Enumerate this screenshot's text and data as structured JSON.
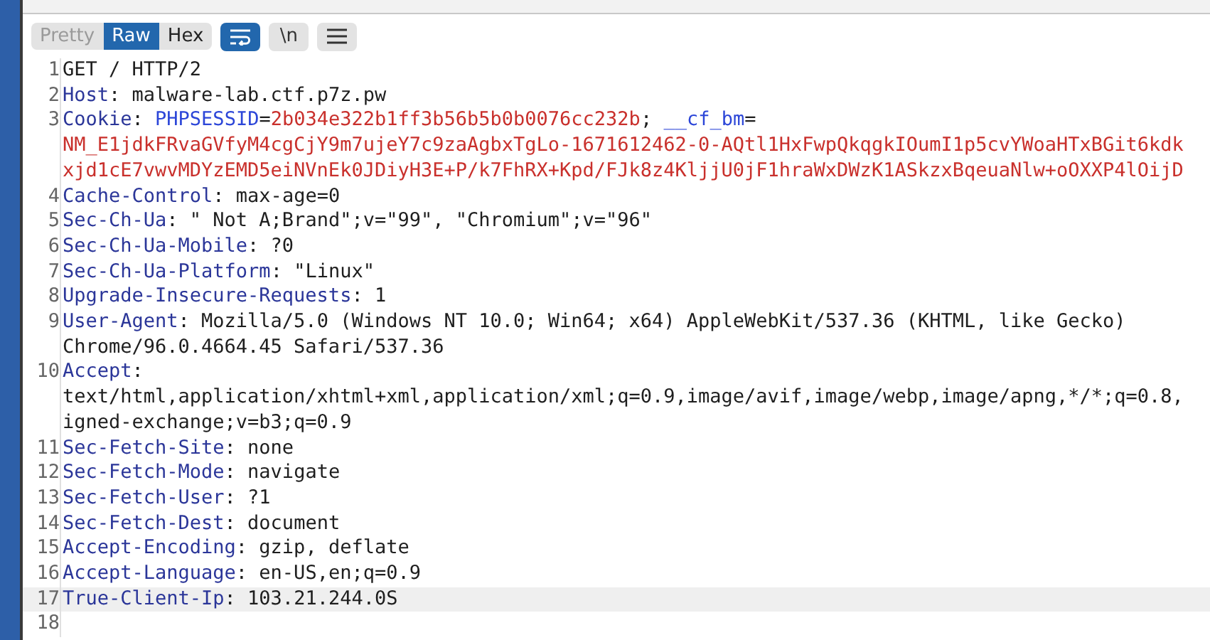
{
  "view_tabs": [
    {
      "label": "Pretty",
      "selected": false
    },
    {
      "label": "Raw",
      "selected": true
    },
    {
      "label": "Hex",
      "selected": false
    }
  ],
  "tools": [
    {
      "kind": "wrap",
      "selected": true
    },
    {
      "kind": "text",
      "label": "\\n",
      "selected": false
    },
    {
      "kind": "menu",
      "selected": false
    }
  ],
  "lines": [
    {
      "number": "1",
      "current": false,
      "rows": [
        [
          {
            "kind": "plain",
            "text": "GET / HTTP/2"
          }
        ]
      ]
    },
    {
      "number": "2",
      "current": false,
      "rows": [
        [
          {
            "kind": "name",
            "text": "Host"
          },
          {
            "kind": "plain",
            "text": ": malware-lab.ctf.p7z.pw"
          }
        ]
      ]
    },
    {
      "number": "3",
      "current": false,
      "rows": [
        [
          {
            "kind": "name",
            "text": "Cookie"
          },
          {
            "kind": "plain",
            "text": ": "
          },
          {
            "kind": "param",
            "text": "PHPSESSID"
          },
          {
            "kind": "plain",
            "text": "="
          },
          {
            "kind": "value",
            "text": "2b034e322b1ff3b56b5b0b0076cc232b"
          },
          {
            "kind": "plain",
            "text": "; "
          },
          {
            "kind": "param",
            "text": "__cf_bm"
          },
          {
            "kind": "plain",
            "text": "="
          }
        ],
        [
          {
            "kind": "value",
            "text": "NM_E1jdkFRvaGVfyM4cgCjY9m7ujeY7c9zaAgbxTgLo-1671612462-0-AQtl1HxFwpQkqgkIOumI1p5cvYWoaHTxBGit6kdk"
          }
        ],
        [
          {
            "kind": "value",
            "text": "xjd1cE7vwvMDYzEMD5eiNVnEk0JDiyH3E+P/k7FhRX+Kpd/FJk8z4KljjU0jF1hraWxDWzK1ASkzxBqeuaNlw+oOXXP4lOijD"
          }
        ]
      ]
    },
    {
      "number": "4",
      "current": false,
      "rows": [
        [
          {
            "kind": "name",
            "text": "Cache-Control"
          },
          {
            "kind": "plain",
            "text": ": max-age=0"
          }
        ]
      ]
    },
    {
      "number": "5",
      "current": false,
      "rows": [
        [
          {
            "kind": "name",
            "text": "Sec-Ch-Ua"
          },
          {
            "kind": "plain",
            "text": ": \" Not A;Brand\";v=\"99\", \"Chromium\";v=\"96\""
          }
        ]
      ]
    },
    {
      "number": "6",
      "current": false,
      "rows": [
        [
          {
            "kind": "name",
            "text": "Sec-Ch-Ua-Mobile"
          },
          {
            "kind": "plain",
            "text": ": ?0"
          }
        ]
      ]
    },
    {
      "number": "7",
      "current": false,
      "rows": [
        [
          {
            "kind": "name",
            "text": "Sec-Ch-Ua-Platform"
          },
          {
            "kind": "plain",
            "text": ": \"Linux\""
          }
        ]
      ]
    },
    {
      "number": "8",
      "current": false,
      "rows": [
        [
          {
            "kind": "name",
            "text": "Upgrade-Insecure-Requests"
          },
          {
            "kind": "plain",
            "text": ": 1"
          }
        ]
      ]
    },
    {
      "number": "9",
      "current": false,
      "rows": [
        [
          {
            "kind": "name",
            "text": "User-Agent"
          },
          {
            "kind": "plain",
            "text": ": Mozilla/5.0 (Windows NT 10.0; Win64; x64) AppleWebKit/537.36 (KHTML, like Gecko)"
          }
        ],
        [
          {
            "kind": "plain",
            "text": "Chrome/96.0.4664.45 Safari/537.36"
          }
        ]
      ]
    },
    {
      "number": "10",
      "current": false,
      "rows": [
        [
          {
            "kind": "name",
            "text": "Accept"
          },
          {
            "kind": "plain",
            "text": ":"
          }
        ],
        [
          {
            "kind": "plain",
            "text": "text/html,application/xhtml+xml,application/xml;q=0.9,image/avif,image/webp,image/apng,*/*;q=0.8,"
          }
        ],
        [
          {
            "kind": "plain",
            "text": "igned-exchange;v=b3;q=0.9"
          }
        ]
      ]
    },
    {
      "number": "11",
      "current": false,
      "rows": [
        [
          {
            "kind": "name",
            "text": "Sec-Fetch-Site"
          },
          {
            "kind": "plain",
            "text": ": none"
          }
        ]
      ]
    },
    {
      "number": "12",
      "current": false,
      "rows": [
        [
          {
            "kind": "name",
            "text": "Sec-Fetch-Mode"
          },
          {
            "kind": "plain",
            "text": ": navigate"
          }
        ]
      ]
    },
    {
      "number": "13",
      "current": false,
      "rows": [
        [
          {
            "kind": "name",
            "text": "Sec-Fetch-User"
          },
          {
            "kind": "plain",
            "text": ": ?1"
          }
        ]
      ]
    },
    {
      "number": "14",
      "current": false,
      "rows": [
        [
          {
            "kind": "name",
            "text": "Sec-Fetch-Dest"
          },
          {
            "kind": "plain",
            "text": ": document"
          }
        ]
      ]
    },
    {
      "number": "15",
      "current": false,
      "rows": [
        [
          {
            "kind": "name",
            "text": "Accept-Encoding"
          },
          {
            "kind": "plain",
            "text": ": gzip, deflate"
          }
        ]
      ]
    },
    {
      "number": "16",
      "current": false,
      "rows": [
        [
          {
            "kind": "name",
            "text": "Accept-Language"
          },
          {
            "kind": "plain",
            "text": ": en-US,en;q=0.9"
          }
        ]
      ]
    },
    {
      "number": "17",
      "current": true,
      "rows": [
        [
          {
            "kind": "name",
            "text": "True-Client-Ip"
          },
          {
            "kind": "plain",
            "text": ": 103.21.244.0S"
          }
        ]
      ]
    },
    {
      "number": "18",
      "current": false
    }
  ]
}
